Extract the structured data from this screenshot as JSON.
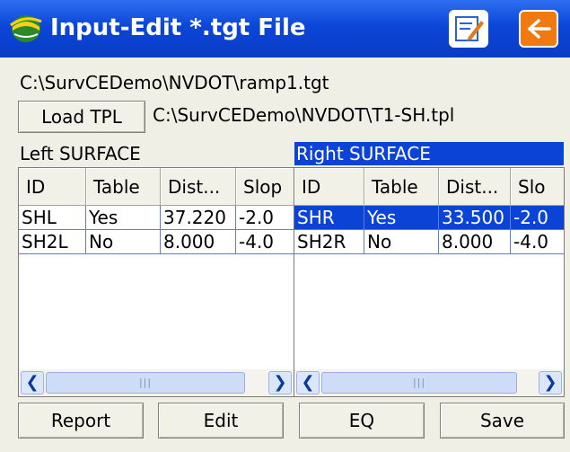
{
  "window": {
    "title": "Input-Edit *.tgt File"
  },
  "file_path": "C:\\SurvCEDemo\\NVDOT\\ramp1.tgt",
  "tpl": {
    "button_label": "Load TPL",
    "path": "C:\\SurvCEDemo\\NVDOT\\T1-SH.tpl"
  },
  "left_surface": {
    "label": "Left SURFACE",
    "columns": [
      "ID",
      "Table",
      "Dist...",
      "Slop"
    ],
    "rows": [
      [
        "SHL",
        "Yes",
        "37.220",
        "-2.0"
      ],
      [
        "SH2L",
        "No",
        "8.000",
        "-4.0"
      ]
    ]
  },
  "right_surface": {
    "label": "Right SURFACE",
    "columns": [
      "ID",
      "Table",
      "Dist...",
      "Slo"
    ],
    "rows": [
      [
        "SHR",
        "Yes",
        "33.500",
        "-2.0"
      ],
      [
        "SH2R",
        "No",
        "8.000",
        "-4.0"
      ]
    ],
    "selected_row": 0
  },
  "buttons": {
    "report": "Report",
    "edit": "Edit",
    "eq": "EQ",
    "save": "Save"
  },
  "icons": [
    "app-logo-icon",
    "edit-note-icon",
    "back-arrow-icon",
    "scroll-left-icon",
    "scroll-right-icon"
  ],
  "colors": {
    "title_bar": "#0b46d8",
    "selection": "#0a43d6",
    "back_button": "#f07a10"
  }
}
